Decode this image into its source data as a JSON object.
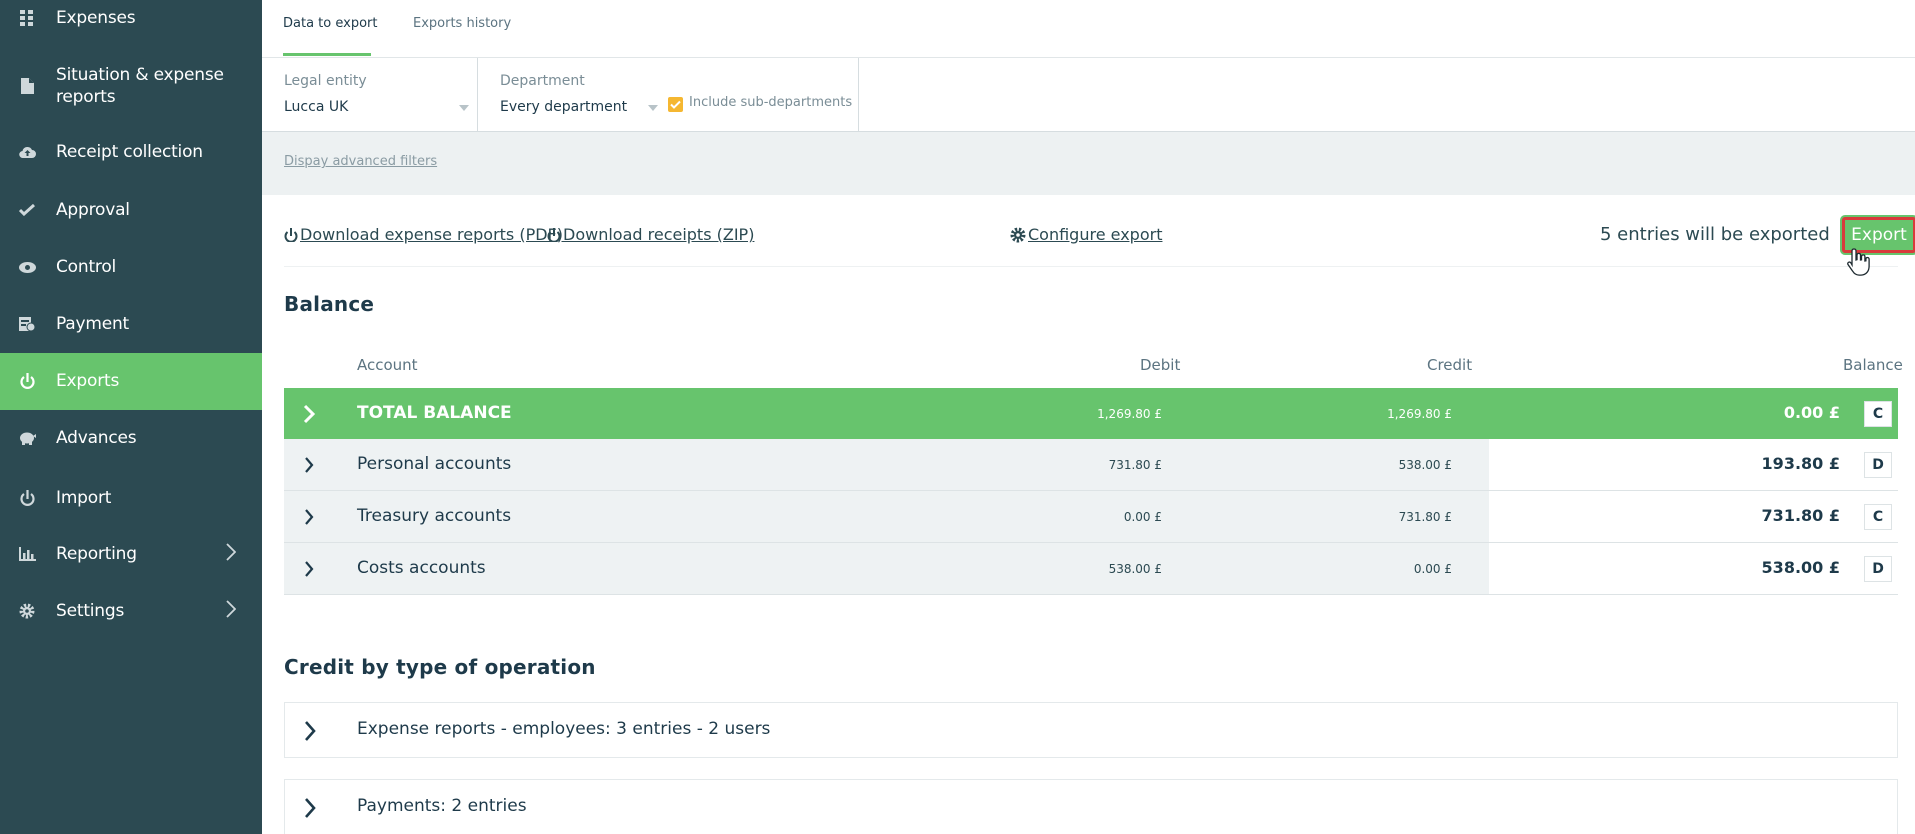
{
  "sidebar": {
    "items": [
      {
        "label": "Expenses",
        "icon": "grid-icon"
      },
      {
        "label": "Situation & expense reports",
        "icon": "document-icon"
      },
      {
        "label": "Receipt collection",
        "icon": "cloud-upload-icon"
      },
      {
        "label": "Approval",
        "icon": "check-icon"
      },
      {
        "label": "Control",
        "icon": "eye-icon"
      },
      {
        "label": "Payment",
        "icon": "payment-icon"
      },
      {
        "label": "Exports",
        "icon": "export-icon",
        "active": true
      },
      {
        "label": "Advances",
        "icon": "piggy-bank-icon"
      },
      {
        "label": "Import",
        "icon": "import-icon"
      },
      {
        "label": "Reporting",
        "icon": "bar-chart-icon",
        "has_submenu": true
      },
      {
        "label": "Settings",
        "icon": "gear-icon",
        "has_submenu": true
      }
    ]
  },
  "tabs": [
    {
      "label": "Data to export",
      "active": true
    },
    {
      "label": "Exports history",
      "active": false
    }
  ],
  "filters": {
    "legal_entity": {
      "label": "Legal entity",
      "value": "Lucca UK"
    },
    "department": {
      "label": "Department",
      "value": "Every department"
    },
    "include_sub": {
      "label": "Include sub-departments",
      "checked": true
    }
  },
  "advanced_filters_link": "Dispay advanced filters",
  "actions": {
    "download_pdf": "Download expense reports (PDF)",
    "download_zip": "Download receipts (ZIP)",
    "configure": "Configure export",
    "entries_count": "5 entries will be exported",
    "export_button": "Export"
  },
  "balance": {
    "title": "Balance",
    "headers": {
      "account": "Account",
      "debit": "Debit",
      "credit": "Credit",
      "balance": "Balance"
    },
    "rows": [
      {
        "account": "TOTAL BALANCE",
        "debit": "1,269.80 £",
        "credit": "1,269.80 £",
        "balance": "0.00 £",
        "dc": "C",
        "total": true
      },
      {
        "account": "Personal accounts",
        "debit": "731.80 £",
        "credit": "538.00 £",
        "balance": "193.80 £",
        "dc": "D"
      },
      {
        "account": "Treasury accounts",
        "debit": "0.00 £",
        "credit": "731.80 £",
        "balance": "731.80 £",
        "dc": "C"
      },
      {
        "account": "Costs accounts",
        "debit": "538.00 £",
        "credit": "0.00 £",
        "balance": "538.00 £",
        "dc": "D"
      }
    ]
  },
  "credit_by_type": {
    "title": "Credit by type of operation",
    "items": [
      {
        "label": "Expense reports - employees: 3 entries - 2 users"
      },
      {
        "label": "Payments: 2 entries"
      }
    ]
  },
  "colors": {
    "sidebar_bg": "#2c4a52",
    "accent_green": "#67c46d",
    "highlight_red": "#d93b3b",
    "checkbox_orange": "#f5b731"
  }
}
